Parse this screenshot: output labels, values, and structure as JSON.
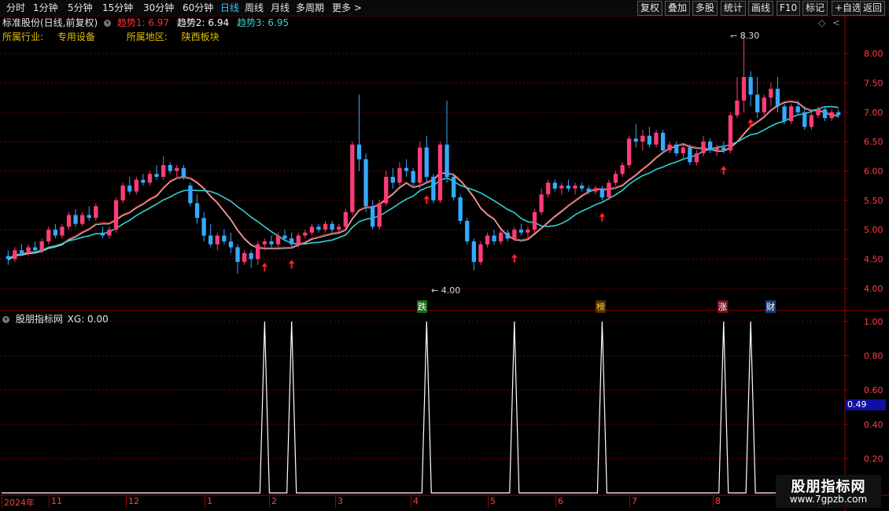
{
  "toolbar": {
    "periods": [
      "分时",
      "1分钟",
      "5分钟",
      "15分钟",
      "30分钟",
      "60分钟",
      "日线",
      "周线",
      "月线",
      "多周期",
      "更多"
    ],
    "active_period": "日线",
    "right_buttons": [
      "复权",
      "叠加",
      "多股",
      "统计",
      "画线",
      "F10",
      "标记",
      "+自选",
      "返回"
    ]
  },
  "header": {
    "stock_label": "标准股份(日线,前复权)",
    "trend1": "趋势1: 6.97",
    "trend2": "趋势2: 6.94",
    "trend3": "趋势3: 6.95",
    "industry_label": "所属行业:",
    "industry": "专用设备",
    "region_label": "所属地区:",
    "region": "陕西板块"
  },
  "price_axis": {
    "labels": [
      "8.00",
      "7.50",
      "7.00",
      "6.50",
      "6.00",
      "5.50",
      "5.00",
      "4.50",
      "4.00"
    ]
  },
  "annotations": {
    "high": "8.30",
    "low": "4.00"
  },
  "event_tags": [
    "跌",
    "榜",
    "涨",
    "财"
  ],
  "indicator": {
    "title": "股朋指标网",
    "xg_label": "XG: 0.00",
    "axis_labels": [
      "1.00",
      "0.80",
      "0.60",
      "0.40",
      "0.20"
    ],
    "current_value": "0.49"
  },
  "date_axis": [
    "2024年",
    "11",
    "12",
    "1",
    "2",
    "3",
    "4",
    "5",
    "6",
    "7",
    "8"
  ],
  "watermark": {
    "name": "股朋指标网",
    "url": "www.7gpzb.com"
  },
  "colors": {
    "up": "#ff3c78",
    "down": "#33aaff",
    "ma_main": "#33d0d0",
    "signal_arrow": "#ff2020",
    "indicator_line": "#ffffff",
    "grid": "#7a0000"
  },
  "chart_data": {
    "type": "candlestick",
    "price_range": [
      3.85,
      8.35
    ],
    "indicator_range": [
      0,
      1.05
    ],
    "signals_on_candle_index": [
      38,
      42,
      62,
      75,
      88,
      106,
      110
    ],
    "candles": [
      [
        4.55,
        4.65,
        4.4,
        4.5
      ],
      [
        4.5,
        4.7,
        4.45,
        4.65
      ],
      [
        4.65,
        4.75,
        4.55,
        4.6
      ],
      [
        4.6,
        4.75,
        4.55,
        4.7
      ],
      [
        4.7,
        4.8,
        4.6,
        4.65
      ],
      [
        4.65,
        4.85,
        4.6,
        4.8
      ],
      [
        4.8,
        5.05,
        4.75,
        5.0
      ],
      [
        5.0,
        5.1,
        4.85,
        4.9
      ],
      [
        4.9,
        5.1,
        4.85,
        5.05
      ],
      [
        5.05,
        5.3,
        5.0,
        5.25
      ],
      [
        5.25,
        5.35,
        5.05,
        5.1
      ],
      [
        5.1,
        5.3,
        5.05,
        5.25
      ],
      [
        5.25,
        5.4,
        5.15,
        5.2
      ],
      [
        5.2,
        5.45,
        5.15,
        5.4
      ],
      [
        4.95,
        5.05,
        4.85,
        4.9
      ],
      [
        4.9,
        5.05,
        4.85,
        5.0
      ],
      [
        5.0,
        5.55,
        4.95,
        5.5
      ],
      [
        5.5,
        5.8,
        5.45,
        5.75
      ],
      [
        5.75,
        5.9,
        5.6,
        5.65
      ],
      [
        5.65,
        5.9,
        5.6,
        5.85
      ],
      [
        5.85,
        5.95,
        5.75,
        5.8
      ],
      [
        5.8,
        6.0,
        5.75,
        5.95
      ],
      [
        5.95,
        6.1,
        5.85,
        5.9
      ],
      [
        5.9,
        6.25,
        5.85,
        6.1
      ],
      [
        6.1,
        6.15,
        5.95,
        6.0
      ],
      [
        6.0,
        6.1,
        5.9,
        6.05
      ],
      [
        6.05,
        6.1,
        5.85,
        5.9
      ],
      [
        5.75,
        5.8,
        5.4,
        5.45
      ],
      [
        5.45,
        5.6,
        5.1,
        5.2
      ],
      [
        5.2,
        5.3,
        4.8,
        4.9
      ],
      [
        4.9,
        5.1,
        4.7,
        4.75
      ],
      [
        4.75,
        4.95,
        4.65,
        4.9
      ],
      [
        4.9,
        5.0,
        4.75,
        4.8
      ],
      [
        4.8,
        4.95,
        4.6,
        4.7
      ],
      [
        4.7,
        4.75,
        4.25,
        4.45
      ],
      [
        4.45,
        4.65,
        4.4,
        4.6
      ],
      [
        4.6,
        4.65,
        4.35,
        4.5
      ],
      [
        4.5,
        4.8,
        4.4,
        4.75
      ],
      [
        4.75,
        4.85,
        4.65,
        4.8
      ],
      [
        4.8,
        4.9,
        4.7,
        4.75
      ],
      [
        4.75,
        4.95,
        4.7,
        4.9
      ],
      [
        4.9,
        5.0,
        4.8,
        4.85
      ],
      [
        4.85,
        4.95,
        4.7,
        4.75
      ],
      [
        4.75,
        4.95,
        4.7,
        4.9
      ],
      [
        4.9,
        5.0,
        4.85,
        4.95
      ],
      [
        4.95,
        5.1,
        4.9,
        5.05
      ],
      [
        5.05,
        5.1,
        4.95,
        5.0
      ],
      [
        5.0,
        5.15,
        4.95,
        5.1
      ],
      [
        5.1,
        5.15,
        4.95,
        5.0
      ],
      [
        5.0,
        5.1,
        4.95,
        5.05
      ],
      [
        5.05,
        5.35,
        5.0,
        5.3
      ],
      [
        5.3,
        6.5,
        5.25,
        6.45
      ],
      [
        6.45,
        7.3,
        6.0,
        6.2
      ],
      [
        6.2,
        6.3,
        5.3,
        5.4
      ],
      [
        5.4,
        5.5,
        5.0,
        5.05
      ],
      [
        5.05,
        5.5,
        5.0,
        5.45
      ],
      [
        5.45,
        6.0,
        5.4,
        5.9
      ],
      [
        5.9,
        6.05,
        5.7,
        5.8
      ],
      [
        5.8,
        6.15,
        5.75,
        6.05
      ],
      [
        6.05,
        6.2,
        5.9,
        6.0
      ],
      [
        6.0,
        6.05,
        5.75,
        5.8
      ],
      [
        5.8,
        6.5,
        5.7,
        6.4
      ],
      [
        6.4,
        6.6,
        5.8,
        5.9
      ],
      [
        5.9,
        5.95,
        5.45,
        5.5
      ],
      [
        5.5,
        6.5,
        5.45,
        6.45
      ],
      [
        6.45,
        7.2,
        5.8,
        5.9
      ],
      [
        5.9,
        5.95,
        5.5,
        5.55
      ],
      [
        5.55,
        5.6,
        5.1,
        5.15
      ],
      [
        5.15,
        5.2,
        4.75,
        4.8
      ],
      [
        4.8,
        4.85,
        4.3,
        4.45
      ],
      [
        4.45,
        4.8,
        4.4,
        4.75
      ],
      [
        4.75,
        4.95,
        4.7,
        4.9
      ],
      [
        4.9,
        5.0,
        4.75,
        4.8
      ],
      [
        4.8,
        5.0,
        4.75,
        4.95
      ],
      [
        4.95,
        5.0,
        4.8,
        4.85
      ],
      [
        4.85,
        5.05,
        4.8,
        5.0
      ],
      [
        5.0,
        5.1,
        4.9,
        4.95
      ],
      [
        4.95,
        5.05,
        4.85,
        5.0
      ],
      [
        5.0,
        5.35,
        4.95,
        5.3
      ],
      [
        5.3,
        5.7,
        5.25,
        5.6
      ],
      [
        5.6,
        5.85,
        5.55,
        5.8
      ],
      [
        5.8,
        5.85,
        5.65,
        5.7
      ],
      [
        5.7,
        5.8,
        5.6,
        5.75
      ],
      [
        5.75,
        5.85,
        5.65,
        5.7
      ],
      [
        5.7,
        5.8,
        5.6,
        5.75
      ],
      [
        5.75,
        5.8,
        5.65,
        5.7
      ],
      [
        5.7,
        5.75,
        5.6,
        5.65
      ],
      [
        5.65,
        5.75,
        5.6,
        5.7
      ],
      [
        5.7,
        5.75,
        5.5,
        5.55
      ],
      [
        5.55,
        5.85,
        5.5,
        5.8
      ],
      [
        5.8,
        6.0,
        5.75,
        5.95
      ],
      [
        5.95,
        6.15,
        5.9,
        6.1
      ],
      [
        6.1,
        6.6,
        6.05,
        6.55
      ],
      [
        6.55,
        6.8,
        6.4,
        6.5
      ],
      [
        6.5,
        6.7,
        6.35,
        6.6
      ],
      [
        6.6,
        6.75,
        6.4,
        6.45
      ],
      [
        6.45,
        6.7,
        6.4,
        6.65
      ],
      [
        6.65,
        6.7,
        6.3,
        6.35
      ],
      [
        6.35,
        6.5,
        6.3,
        6.45
      ],
      [
        6.45,
        6.5,
        6.25,
        6.3
      ],
      [
        6.3,
        6.45,
        6.2,
        6.4
      ],
      [
        6.4,
        6.45,
        6.1,
        6.15
      ],
      [
        6.15,
        6.35,
        6.1,
        6.3
      ],
      [
        6.3,
        6.6,
        6.25,
        6.5
      ],
      [
        6.5,
        6.55,
        6.3,
        6.35
      ],
      [
        6.35,
        6.45,
        6.25,
        6.4
      ],
      [
        6.4,
        6.5,
        6.3,
        6.35
      ],
      [
        6.35,
        7.0,
        6.3,
        6.95
      ],
      [
        6.95,
        7.6,
        6.9,
        7.2
      ],
      [
        7.2,
        8.3,
        7.0,
        7.6
      ],
      [
        7.6,
        7.7,
        7.1,
        7.3
      ],
      [
        7.3,
        7.6,
        6.9,
        7.0
      ],
      [
        7.0,
        7.3,
        6.95,
        7.25
      ],
      [
        7.25,
        7.5,
        7.1,
        7.4
      ],
      [
        7.4,
        7.6,
        7.0,
        7.1
      ],
      [
        7.1,
        7.15,
        6.8,
        6.85
      ],
      [
        6.85,
        7.15,
        6.8,
        7.1
      ],
      [
        7.1,
        7.2,
        6.95,
        7.0
      ],
      [
        7.0,
        7.1,
        6.7,
        6.75
      ],
      [
        6.75,
        7.0,
        6.7,
        6.95
      ],
      [
        6.95,
        7.1,
        6.9,
        7.05
      ],
      [
        7.05,
        7.1,
        6.85,
        6.9
      ],
      [
        6.9,
        7.05,
        6.85,
        7.0
      ],
      [
        7.0,
        7.05,
        6.9,
        6.95
      ]
    ]
  }
}
